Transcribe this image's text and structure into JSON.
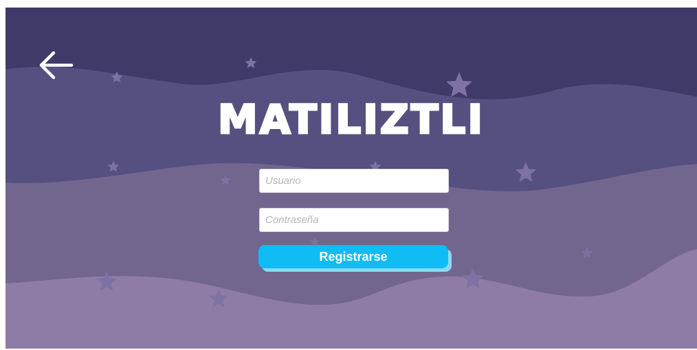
{
  "app": {
    "title": "MATILIZTLI"
  },
  "nav": {
    "back_icon": "arrow-left-icon"
  },
  "form": {
    "username_placeholder": "Usuario",
    "password_placeholder": "Contraseña",
    "submit_label": "Registrarse"
  },
  "colors": {
    "sky": "#3f3a68",
    "wave_1": "#55507f",
    "wave_2": "#72668f",
    "wave_3": "#8f7ca6",
    "star": "#7d72a3",
    "button": "#0fbcf3",
    "button_shadow": "#8fd8f2"
  }
}
